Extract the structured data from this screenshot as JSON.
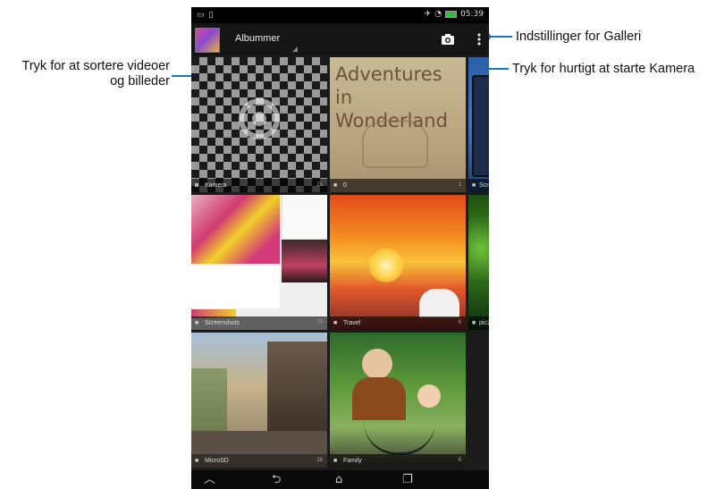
{
  "callouts": {
    "sort": [
      "Tryk for at sortere videoer",
      "og billeder"
    ],
    "settings": "Indstillinger for Galleri",
    "camera": "Tryk for hurtigt at starte Kamera"
  },
  "status_bar": {
    "time": "05:39"
  },
  "action_bar": {
    "title": "Albummer"
  },
  "albums": [
    {
      "name": "Kamera",
      "count": "21",
      "icon": "camera-icon"
    },
    {
      "name": "0",
      "count": "1",
      "icon": "folder-icon",
      "image_text": [
        "Adventures",
        "in Wonderland"
      ]
    },
    {
      "name": "Scre",
      "count": "",
      "icon": "folder-icon"
    },
    {
      "name": "Screenshots",
      "count": "75",
      "icon": "folder-icon"
    },
    {
      "name": "Travel",
      "count": "6",
      "icon": "folder-icon"
    },
    {
      "name": "pic2",
      "count": "",
      "icon": "folder-icon"
    },
    {
      "name": "MicroSD",
      "count": "16",
      "icon": "folder-icon"
    },
    {
      "name": "Family",
      "count": "6",
      "icon": "folder-icon"
    }
  ],
  "nav_bar": {
    "icons": [
      "recent-apps-up-icon",
      "back-icon",
      "home-icon",
      "recent-apps-icon"
    ]
  },
  "colors": {
    "callout_line": "#1a73c8",
    "device_bg": "#1b1b1b"
  }
}
